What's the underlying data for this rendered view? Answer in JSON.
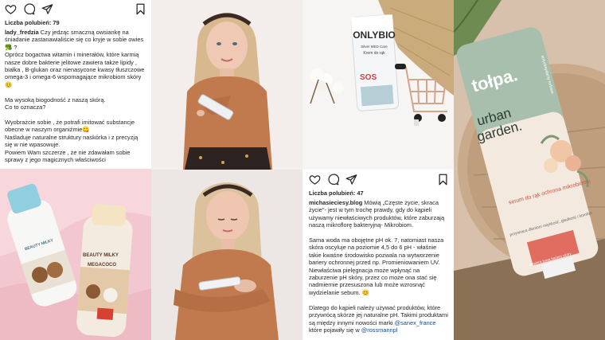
{
  "post1": {
    "likes": "Liczba polubień: 79",
    "username": "lady_fredzia",
    "caption": " Czy jedząc smaczną owsiankę na śniadanie zastanawialiście się co kryje w sobie owies🥦 ?\nOprócz bogactwa witamin i minerałów, które karmią nasze dobre bakterie jelitowe zawiera także lipidy , białka , B-glukan oraz nienasycone kwasy tłuszczowe omega-3 i omega-6 wspomagające mikrobiom skóry😊\n\nMa wysoką biogodność z naszą skórą.\nCo to oznacza?\n\nWyobrażcie sobie , że potrafi imitować substancje obecne w naszym organiźmie😋\nNaśladuje naturalne struktury naskórka i z precyzją się w nie wpasowuje.\nPowiem Wam szczerze , że nie zdawałam sobie sprawy z jego magicznych właściwości"
  },
  "post2": {
    "likes": "Liczba polubień: 47",
    "username": "michasieciesy.blog",
    "caption": " Mówią „Częste życie, skraca życie\"- jest w tym trochę prawdy, gdy do kąpieli używamy niewłaściwych produktów, które zaburzają naszą mikroflorę bakteryjną- Mikrobiom.\n\nSama woda ma obojętne pH ok. 7, natomiast nasza skóra oscyluje na poziomie 4,5 do 6 pH - właśnie takie kwaśne środowisko pozwala na wytworzenie bariery ochronnej przed np. Promieniowaniem UV. Niewłaściwa pielęgnacja może wpłynąć na zaburzenie pH skóry, przez co może ona stać się nadmiernie przesuszona lub może wzrosnąć wydzielanie sebum. 😊\n\nDlatego do kąpieli należy używać produktów, które przywrócą skórze jej naturalne pH. Takimi produktami są między innymi nowości marki ",
    "mention1": "@sanex_france",
    "caption_tail": " które pojawiły się w ",
    "mention2": "@rossmannpl"
  },
  "product_onlybio": {
    "brand": "ONLYBIO",
    "line": "Silver MED Care",
    "name": "Krem do rąk",
    "badge": "SOS"
  },
  "product_tolpa": {
    "brand": "tołpa.",
    "tag": "antyoksydanty torfowe",
    "line1": "urban",
    "line2": "garden.",
    "name": "serum do rąk ochrona mikrobiomu",
    "claims": "przywraca dłoniom miękkość, gładkość i komfort",
    "badge": "wspiera żywą barierę skóry"
  },
  "product_bielenda": {
    "label1": "BEAUTY MILKY",
    "label2": "BEAUTY MILKY",
    "label3": "MEGACOCO"
  },
  "colors": {
    "ig_text": "#262626",
    "mention": "#1a4a8a",
    "pink_bg": "#f3c7cf",
    "sweater": "#c07a4e",
    "tolpa_green": "#9db3a3"
  },
  "icons": [
    "heart-icon",
    "comment-icon",
    "share-icon",
    "bookmark-icon"
  ]
}
